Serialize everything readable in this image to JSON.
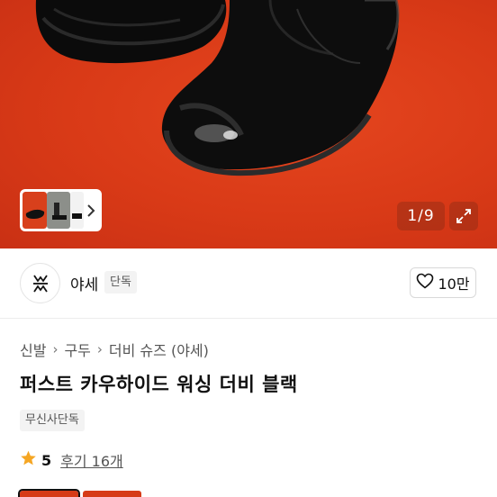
{
  "product_image": {
    "pager_text": "1/9",
    "pager_current": 1,
    "pager_total": 9,
    "colors": {
      "background": "#d93a17",
      "shoe": "#0d0d0d"
    }
  },
  "thumbnail_strip": {
    "more_icon": "chevron-right-icon"
  },
  "zoom": {
    "icon": "expand-icon"
  },
  "brand": {
    "name": "야세",
    "tag": "단독",
    "logo_icon": "brand-logo-icon"
  },
  "like": {
    "icon": "heart-outline-icon",
    "count": "10만"
  },
  "breadcrumb": {
    "items": [
      "신발",
      "구두",
      "더비 슈즈 (야세)"
    ],
    "separator_icon": "chevron-right-icon"
  },
  "product": {
    "title": "퍼스트 카우하이드 워싱 더비 블랙",
    "badge": "무신사단독"
  },
  "rating": {
    "icon": "star-icon",
    "score": "5",
    "reviews_label": "후기 16개",
    "star_color": "#f5a623"
  }
}
